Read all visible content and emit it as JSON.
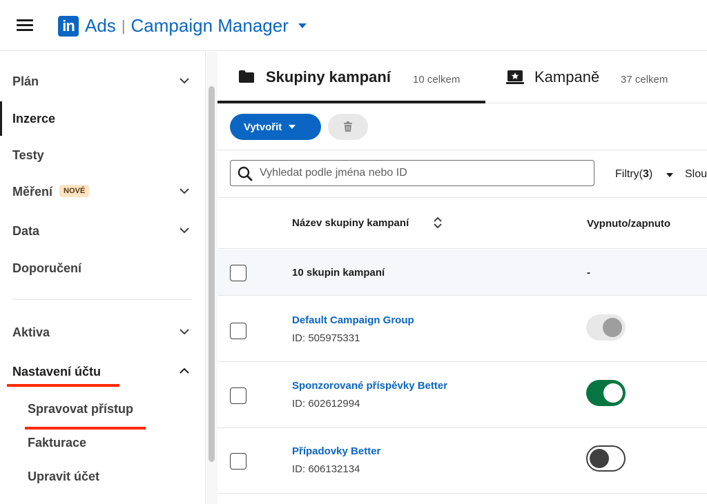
{
  "header": {
    "logo_text": "in",
    "product": "Ads",
    "separator": "|",
    "app_name": "Campaign Manager"
  },
  "sidebar": {
    "items": [
      {
        "label": "Plán",
        "expandable": true
      },
      {
        "label": "Inzerce",
        "active": true
      },
      {
        "label": "Testy"
      },
      {
        "label": "Měření",
        "badge": "NOVÉ",
        "expandable": true
      },
      {
        "label": "Data",
        "expandable": true
      },
      {
        "label": "Doporučení"
      },
      {
        "label": "Aktiva",
        "expandable": true
      },
      {
        "label": "Nastavení účtu",
        "expanded": true
      },
      {
        "label": "Spravovat přístup"
      },
      {
        "label": "Fakturace"
      },
      {
        "label": "Upravit účet"
      }
    ]
  },
  "tabs": [
    {
      "label": "Skupiny kampaní",
      "count": "10 celkem",
      "active": true,
      "icon": "folder-icon"
    },
    {
      "label": "Kampaně",
      "count": "37 celkem",
      "icon": "campaign-star-icon"
    }
  ],
  "toolbar": {
    "create_label": "Vytvořit",
    "delete_icon": "trash-icon"
  },
  "search": {
    "placeholder": "Vyhledat podle jména nebo ID",
    "value": ""
  },
  "filters": {
    "label": "Filtry(",
    "count": "3",
    "close": ")",
    "columns_label": "Slou"
  },
  "table": {
    "columns": [
      "Název skupiny kampaní",
      "Vypnuto/zapnuto"
    ],
    "summary": {
      "label": "10 skupin kampaní",
      "toggle": "-"
    },
    "rows": [
      {
        "name": "Default Campaign Group",
        "id": "ID: 505975331",
        "status": "disabled"
      },
      {
        "name": "Sponzorované příspěvky Better",
        "id": "ID: 602612994",
        "status": "on"
      },
      {
        "name": "Případovky Better",
        "id": "ID: 606132134",
        "status": "off"
      }
    ]
  },
  "colors": {
    "brand": "#0a66c2",
    "toggle_on": "#057642",
    "annotation_red": "#ff2a00"
  }
}
